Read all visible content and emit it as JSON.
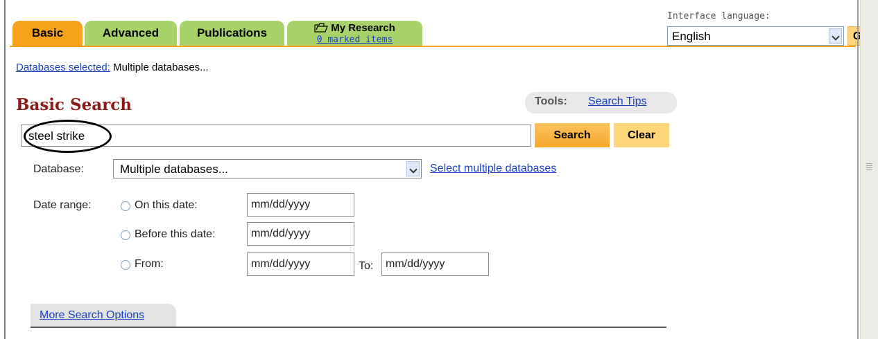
{
  "tabs": {
    "basic": "Basic",
    "advanced": "Advanced",
    "publications": "Publications",
    "my_research_title": "My Research",
    "my_research_marked": "0 marked items"
  },
  "language": {
    "label": "Interface language:",
    "selected": "English",
    "go_label": "Go"
  },
  "databases_selected": {
    "link": "Databases selected:",
    "value": "Multiple databases..."
  },
  "page_title": "Basic Search",
  "tools": {
    "label": "Tools:",
    "search_tips": "Search Tips"
  },
  "search": {
    "value": "steel strike",
    "search_label": "Search",
    "clear_label": "Clear"
  },
  "database": {
    "label": "Database:",
    "selected": "Multiple databases...",
    "select_multiple_link": "Select multiple databases"
  },
  "date_range": {
    "label": "Date range:",
    "on_this_date": "On this date:",
    "before_this_date": "Before this date:",
    "from": "From:",
    "to": "To:",
    "placeholder": "mm/dd/yyyy"
  },
  "more_search_options": "More Search Options",
  "colors": {
    "active_tab": "#f7a21b",
    "inactive_tab": "#a7d36a",
    "title": "#8b1a1a",
    "link": "#1a3fbf"
  }
}
